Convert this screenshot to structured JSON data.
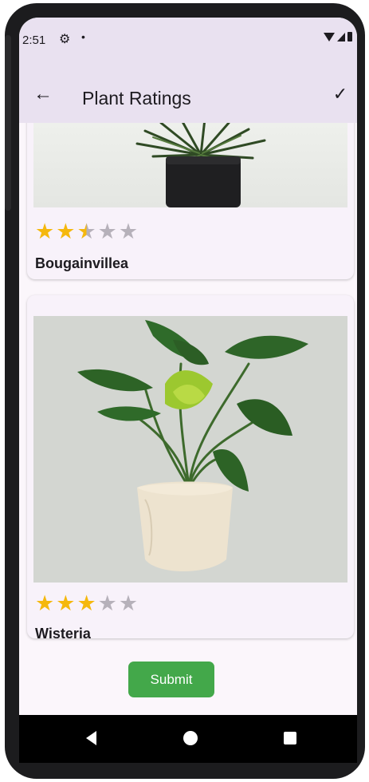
{
  "status_bar": {
    "time": "2:51",
    "settings_icon": "gear-icon",
    "notification_dot": "•"
  },
  "app_bar": {
    "back_icon": "←",
    "title": "Plant Ratings",
    "confirm_icon": "✓"
  },
  "plants": [
    {
      "name": "Bougainvillea",
      "rating": 2.5,
      "max_rating": 5
    },
    {
      "name": "Wisteria",
      "rating": 3,
      "max_rating": 5
    }
  ],
  "submit_label": "Submit",
  "colors": {
    "accent": "#43a84a",
    "star_on": "#f5b80d",
    "star_off": "#b6b1ba",
    "app_bar": "#e9e1f0"
  }
}
